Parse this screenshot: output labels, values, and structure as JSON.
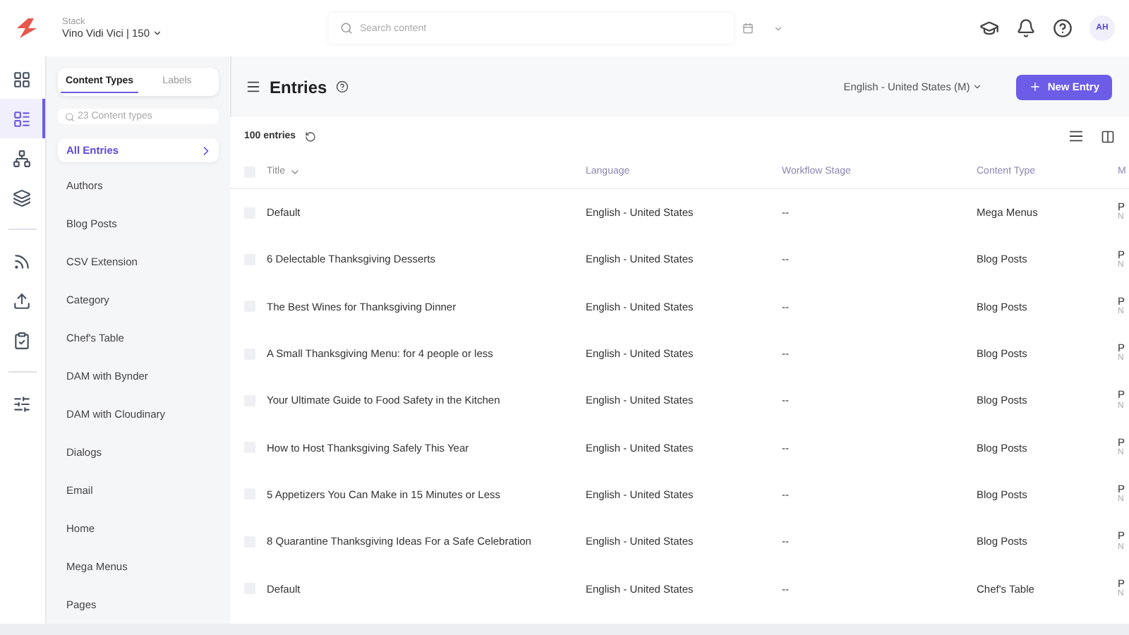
{
  "topbar": {
    "stack_label": "Stack",
    "stack_name": "Vino Vidi Vici | 150",
    "search": {
      "placeholder": "Search content"
    },
    "avatar": "AH"
  },
  "rail": [
    {
      "kind": "dashboard",
      "selected": false
    },
    {
      "kind": "entries",
      "selected": true
    },
    {
      "kind": "models",
      "selected": false
    },
    {
      "kind": "assets",
      "selected": false
    },
    {
      "kind": "divider"
    },
    {
      "kind": "releases",
      "selected": false
    },
    {
      "kind": "publish",
      "selected": false
    },
    {
      "kind": "tasks",
      "selected": false
    },
    {
      "kind": "divider"
    },
    {
      "kind": "settings",
      "selected": false
    }
  ],
  "sidebar": {
    "tabs": [
      {
        "label": "Content Types",
        "selected": true
      },
      {
        "label": "Labels",
        "selected": false
      }
    ],
    "search": {
      "placeholder": "23 Content types"
    },
    "all_entries": "All Entries",
    "items": [
      "Authors",
      "Blog Posts",
      "CSV Extension",
      "Category",
      "Chef's Table",
      "DAM with Bynder",
      "DAM with Cloudinary",
      "Dialogs",
      "Email",
      "Home",
      "Mega Menus",
      "Pages"
    ]
  },
  "header": {
    "title": "Entries",
    "locale": "English - United States (M)",
    "new_button": "New Entry"
  },
  "table": {
    "count": "100 entries",
    "select_all_checked": false,
    "columns": [
      "Title",
      "Language",
      "Workflow Stage",
      "Content Type",
      "M"
    ],
    "rows": [
      {
        "checked": false,
        "title": "Default",
        "language": "English - United States",
        "stage": "--",
        "type": "Mega Menus",
        "column_5": [
          "P",
          "N"
        ]
      },
      {
        "checked": false,
        "title": "6 Delectable Thanksgiving Desserts",
        "language": "English - United States",
        "stage": "--",
        "type": "Blog Posts",
        "column_5": [
          "P",
          "N"
        ]
      },
      {
        "checked": false,
        "title": "The Best Wines for Thanksgiving Dinner",
        "language": "English - United States",
        "stage": "--",
        "type": "Blog Posts",
        "column_5": [
          "P",
          "N"
        ]
      },
      {
        "checked": false,
        "title": "A Small Thanksgiving Menu: for 4 people or less",
        "language": "English - United States",
        "stage": "--",
        "type": "Blog Posts",
        "column_5": [
          "P",
          "N"
        ]
      },
      {
        "checked": false,
        "title": "Your Ultimate Guide to Food Safety in the Kitchen",
        "language": "English - United States",
        "stage": "--",
        "type": "Blog Posts",
        "column_5": [
          "P",
          "N"
        ]
      },
      {
        "checked": false,
        "title": "How to Host Thanksgiving Safely This Year",
        "language": "English - United States",
        "stage": "--",
        "type": "Blog Posts",
        "column_5": [
          "P",
          "N"
        ]
      },
      {
        "checked": false,
        "title": "5 Appetizers You Can Make in 15 Minutes or Less",
        "language": "English - United States",
        "stage": "--",
        "type": "Blog Posts",
        "column_5": [
          "P",
          "N"
        ]
      },
      {
        "checked": false,
        "title": "8 Quarantine Thanksgiving Ideas For a Safe Celebration",
        "language": "English - United States",
        "stage": "--",
        "type": "Blog Posts",
        "column_5": [
          "P",
          "N"
        ]
      },
      {
        "checked": false,
        "title": "Default",
        "language": "English - United States",
        "stage": "--",
        "type": "Chef's Table",
        "column_5": [
          "P",
          "N"
        ]
      }
    ]
  }
}
